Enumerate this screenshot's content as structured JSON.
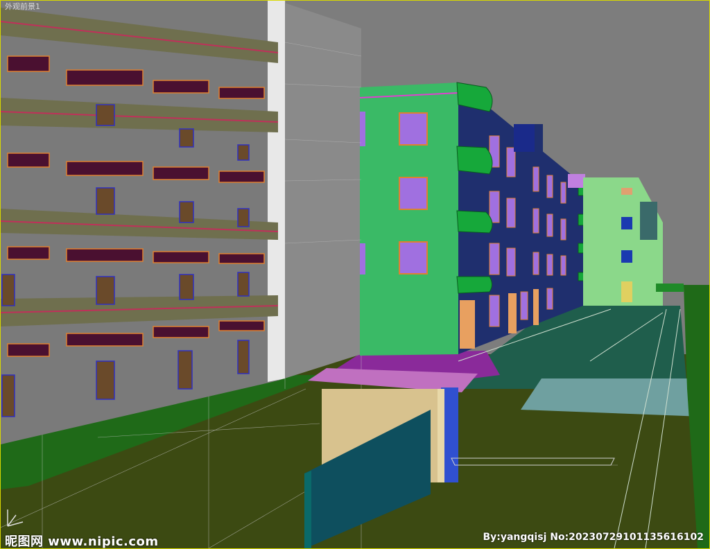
{
  "viewport": {
    "label": "外观前景1",
    "border_color": "#d8d800"
  },
  "watermark": {
    "left": "昵图网 www.nipic.com",
    "right": "By:yangqisj No:20230729101135616102"
  },
  "colors": {
    "background": "#7d7d7d",
    "left_building": "#7a7a7a",
    "green_building": "#3aba66",
    "navy_building": "#1f2f6e",
    "far_building": "#8bd88a",
    "ground": "#3c4a12",
    "lawn": "#1f6a18",
    "road": "#1f5e4c",
    "guard_house": "#d8c28e",
    "wall": "#0e4f5e",
    "window_purple": "#a070e0",
    "window_frame": "#e08030",
    "balcony_green": "#16a83a"
  },
  "icons": [
    "axis-gizmo-icon"
  ]
}
